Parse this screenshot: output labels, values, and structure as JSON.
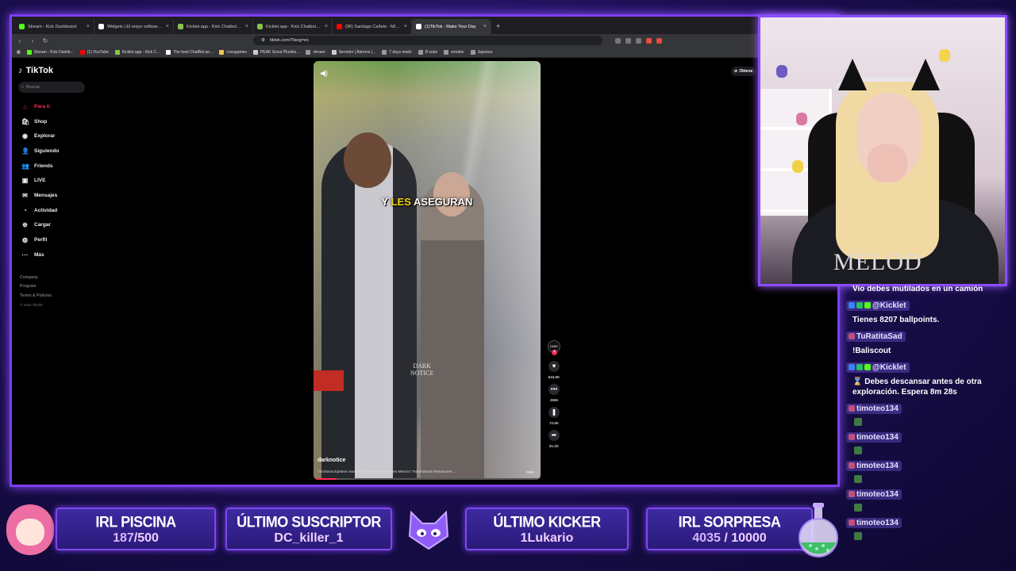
{
  "browser": {
    "tabs": [
      {
        "label": "Stream - Kick Dashboard",
        "color": "#53fc18",
        "active": false
      },
      {
        "label": "Widgets | El mejor software para ge",
        "color": "#ffffff",
        "active": false
      },
      {
        "label": "Kicklet.app - Kick Chatbot and Overl",
        "color": "#8bc34a",
        "active": false
      },
      {
        "label": "Kicklet.app - Kick Chatbot and Overl",
        "color": "#8bc34a",
        "active": false
      },
      {
        "label": "(96) Santiago Cañete - MIX CUMBIE",
        "color": "#ff0000",
        "active": false
      },
      {
        "label": "(1)TikTok - Make Your Day",
        "color": "#ffffff",
        "active": true
      }
    ],
    "new_tab": "+",
    "url": "tiktok.com/?lang=es",
    "bookmarks": [
      {
        "label": "Stream - Kick Dashb...",
        "color": "#53fc18"
      },
      {
        "label": "(1) YouTube",
        "color": "#ff0000"
      },
      {
        "label": "Kicklet.app - Kick C...",
        "color": "#8bc34a"
      },
      {
        "label": "The best ChatBot an...",
        "color": "#ffffff"
      },
      {
        "label": "Lessgames",
        "color": "#f2c94c"
      },
      {
        "label": "PEAK Scout Plushie...",
        "color": "#cccccc"
      },
      {
        "label": "stream",
        "color": "#999999"
      },
      {
        "label": "Servidor | Aternos |...",
        "color": "#cccccc"
      },
      {
        "label": "7 days mods",
        "color": "#999999"
      },
      {
        "label": "R subs",
        "color": "#999999"
      },
      {
        "label": "emotes",
        "color": "#999999"
      },
      {
        "label": "Japones",
        "color": "#999999"
      }
    ]
  },
  "tiktok": {
    "logo": "TikTok",
    "search_placeholder": "Buscar",
    "nav": [
      {
        "label": "Para ti",
        "icon": "home-icon",
        "glyph": "⌂",
        "active": true
      },
      {
        "label": "Shop",
        "icon": "shop-icon",
        "glyph": "🛍",
        "active": false
      },
      {
        "label": "Explorar",
        "icon": "compass-icon",
        "glyph": "◉",
        "active": false
      },
      {
        "label": "Siguiendo",
        "icon": "following-icon",
        "glyph": "👤",
        "active": false
      },
      {
        "label": "Friends",
        "icon": "friends-icon",
        "glyph": "👥",
        "active": false
      },
      {
        "label": "LIVE",
        "icon": "live-icon",
        "glyph": "▣",
        "active": false
      },
      {
        "label": "Mensajes",
        "icon": "messages-icon",
        "glyph": "✉",
        "active": false
      },
      {
        "label": "Actividad",
        "icon": "activity-icon",
        "glyph": "◔",
        "active": false
      },
      {
        "label": "Cargar",
        "icon": "upload-icon",
        "glyph": "⊕",
        "active": false
      },
      {
        "label": "Perfil",
        "icon": "profile-icon",
        "glyph": "◍",
        "active": false
      },
      {
        "label": "Más",
        "icon": "more-icon",
        "glyph": "···",
        "active": false
      }
    ],
    "footer": [
      "Company",
      "Program",
      "Terms & Policies"
    ],
    "copyright": "© 2024 TikTok",
    "obtain_button": "Obtene",
    "video": {
      "caption_pre": "Y",
      "caption_highlight": "LES",
      "caption_post": "ASEGURAN",
      "watermark_line1": "DARK",
      "watermark_line2": "NOTICE",
      "author": "darknotice",
      "description": "\"Archivos Epstein reavivan videos olvidados en México\" #ultimahora #mexicoes ...",
      "more": "más",
      "avatar_text": "DARK",
      "progress": 0.1
    },
    "actions": [
      {
        "icon": "heart-icon",
        "glyph": "♥",
        "count": "644.6K"
      },
      {
        "icon": "comment-icon",
        "glyph": "•••",
        "count": "4566"
      },
      {
        "icon": "bookmark-icon",
        "glyph": "❚",
        "count": "70.8K"
      },
      {
        "icon": "share-icon",
        "glyph": "➦",
        "count": "51.2K"
      }
    ]
  },
  "webcam": {
    "shirt_text": "MELOD"
  },
  "chat": {
    "top_partial": "Vio debes mutilados en un camión",
    "messages": [
      {
        "user": "@Kicklet",
        "text": "Tienes 8207 ballpoints.",
        "emote": false
      },
      {
        "user": "TuRatitaSad",
        "text": "!Baliscout",
        "emote": false
      },
      {
        "user": "@Kicklet",
        "text": "⌛ Debes descansar antes de otra exploración. Espera 8m 28s",
        "emote": false
      },
      {
        "user": "timoteo134",
        "text": "",
        "emote": true
      },
      {
        "user": "timoteo134",
        "text": "",
        "emote": true
      },
      {
        "user": "timoteo134",
        "text": "",
        "emote": true
      },
      {
        "user": "timoteo134",
        "text": "",
        "emote": true
      },
      {
        "user": "timoteo134",
        "text": "",
        "emote": true
      }
    ]
  },
  "widgets": {
    "pool": {
      "title": "IRL PISCINA",
      "current": "187",
      "goal": "/500"
    },
    "subscriber": {
      "title": "ÚLTIMO SUSCRIPTOR",
      "value": "DC_killer_1"
    },
    "kicker": {
      "title": "ÚLTIMO KICKER",
      "value": "1Lukario"
    },
    "surprise": {
      "title": "IRL SORPRESA",
      "current": "4035",
      "goal": " / 10000"
    }
  },
  "colors": {
    "accent": "#7b3ff2",
    "tiktok_red": "#fe2c55",
    "caption_yellow": "#f5d90a"
  }
}
